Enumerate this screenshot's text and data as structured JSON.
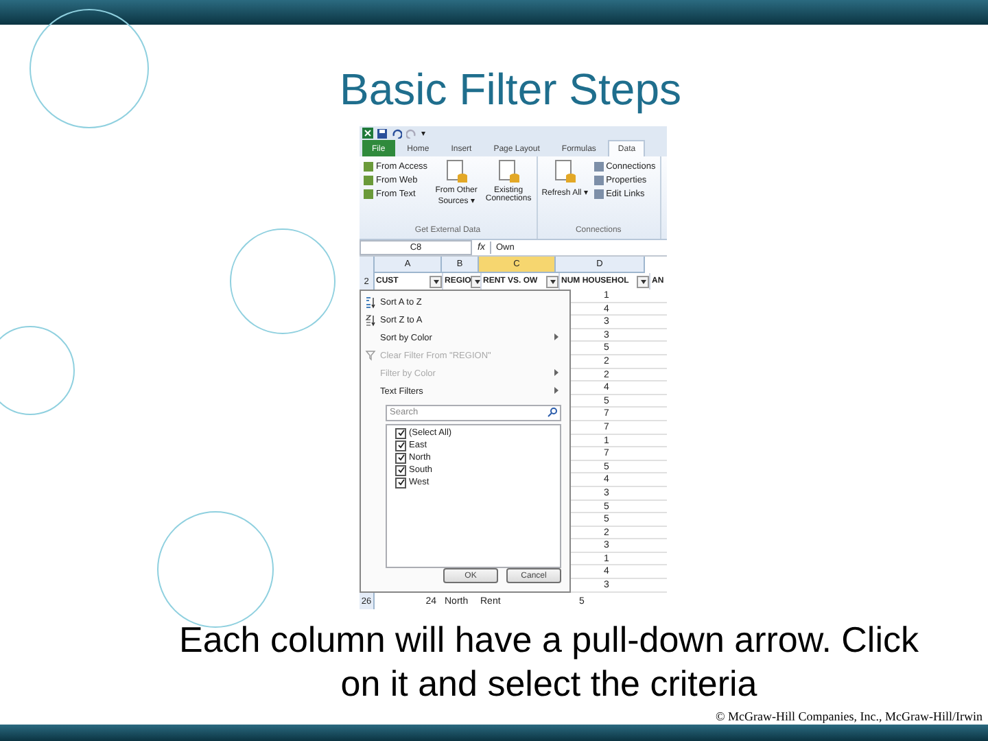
{
  "title": "Basic Filter Steps",
  "excel": {
    "quick_access": [
      "▾"
    ],
    "tabs": [
      {
        "label": "File",
        "kind": "file",
        "selected": false
      },
      {
        "label": "Home",
        "kind": "tab",
        "selected": false
      },
      {
        "label": "Insert",
        "kind": "tab",
        "selected": false
      },
      {
        "label": "Page Layout",
        "kind": "tab",
        "selected": false
      },
      {
        "label": "Formulas",
        "kind": "tab",
        "selected": false
      },
      {
        "label": "Data",
        "kind": "tab",
        "selected": true
      }
    ],
    "ribbon_groups": [
      {
        "label": "Get External Data",
        "small": [
          "From Access",
          "From Web",
          "From Text"
        ],
        "large": [
          "From Other Sources ▾",
          "Existing Connections"
        ]
      },
      {
        "label": "Connections",
        "large": [
          "Refresh All ▾"
        ],
        "small": [
          "Connections",
          "Properties",
          "Edit Links"
        ]
      }
    ],
    "name_box": "C8",
    "fx": "fx",
    "formula": "Own",
    "columns": [
      {
        "label": "A",
        "selected": false
      },
      {
        "label": "B",
        "selected": false
      },
      {
        "label": "C",
        "selected": true
      },
      {
        "label": "D",
        "selected": false
      }
    ],
    "header_row": {
      "number": "2",
      "cells": [
        "CUST",
        "REGIO",
        "RENT VS. OW",
        "NUM HOUSEHOL",
        "AN"
      ]
    },
    "menu": {
      "items": [
        {
          "label": "Sort A to Z",
          "kind": "sort-asc",
          "disabled": false,
          "submenu": false
        },
        {
          "label": "Sort Z to A",
          "kind": "sort-desc",
          "disabled": false,
          "submenu": false
        },
        {
          "label": "Sort by Color",
          "kind": "plain",
          "disabled": false,
          "submenu": true
        },
        {
          "label": "Clear Filter From \"REGION\"",
          "kind": "clear",
          "disabled": true,
          "submenu": false
        },
        {
          "label": "Filter by Color",
          "kind": "plain",
          "disabled": true,
          "submenu": true
        },
        {
          "label": "Text Filters",
          "kind": "plain",
          "disabled": false,
          "submenu": true
        }
      ],
      "search": {
        "placeholder": "Search"
      },
      "options": [
        {
          "label": "(Select All)",
          "checked": true
        },
        {
          "label": "East",
          "checked": true
        },
        {
          "label": "North",
          "checked": true
        },
        {
          "label": "South",
          "checked": true
        },
        {
          "label": "West",
          "checked": true
        }
      ],
      "buttons": [
        "OK",
        "Cancel"
      ]
    },
    "column_d": [
      "1",
      "4",
      "3",
      "3",
      "5",
      "2",
      "2",
      "4",
      "5",
      "7",
      "7",
      "1",
      "7",
      "5",
      "4",
      "3",
      "5",
      "5",
      "2",
      "3",
      "1",
      "4",
      "3"
    ],
    "last_row": {
      "number": "26",
      "cells": [
        "24",
        "North",
        "Rent",
        "5"
      ]
    }
  },
  "caption": [
    "Each column will have a pull-down arrow.  Click",
    "on it and select the criteria"
  ],
  "footer": "© McGraw-Hill Companies, Inc., McGraw-Hill/Irwin"
}
